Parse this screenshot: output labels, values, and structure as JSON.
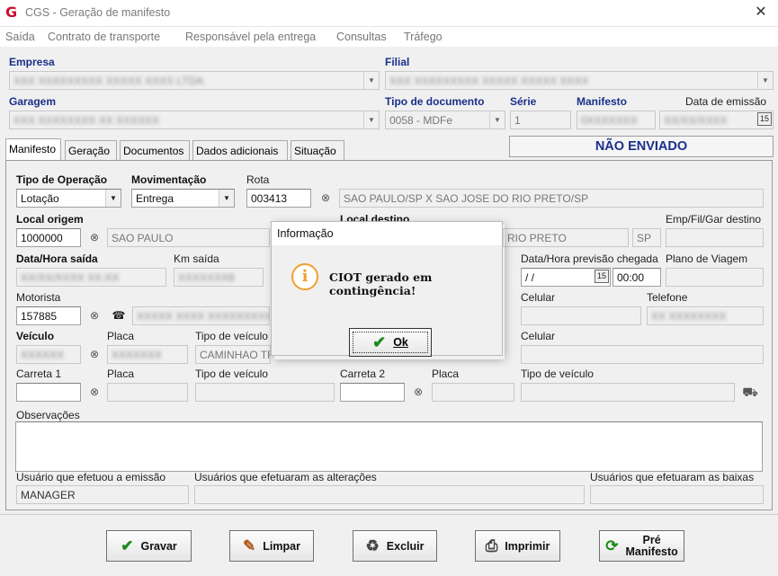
{
  "window": {
    "title": "CGS - Geração de manifesto",
    "close": "✕"
  },
  "menu": [
    "Saída",
    "Contrato de transporte",
    "Responsável pela entrega",
    "Consultas",
    "Tráfego"
  ],
  "header": {
    "empresa_label": "Empresa",
    "empresa_value": "XXX XXXXXXXXX XXXXX XXXX LTDA",
    "filial_label": "Filial",
    "filial_value": "XXX XXXXXXXXX XXXXX XXXXX XXXX",
    "garagem_label": "Garagem",
    "garagem_value": "XXX XXXXXXXX XX XXXXXX",
    "tipo_doc_label": "Tipo de documento",
    "tipo_doc_value": "0058 - MDFe",
    "serie_label": "Série",
    "serie_value": "1",
    "manifesto_label": "Manifesto",
    "manifesto_value": "0XXXXXXX",
    "data_emissao_label": "Data de emissão",
    "data_emissao_value": "XX/XX/XXXX",
    "calendar_glyph": "15"
  },
  "tabs": [
    "Manifesto",
    "Geração",
    "Documentos",
    "Dados adicionais",
    "Situação"
  ],
  "status": "NÃO ENVIADO",
  "form": {
    "tipo_operacao_label": "Tipo de Operação",
    "tipo_operacao_value": "Lotação",
    "movimentacao_label": "Movimentação",
    "movimentacao_value": "Entrega",
    "rota_label": "Rota",
    "rota_value": "003413",
    "rota_desc": "SAO PAULO/SP X SAO JOSE DO RIO PRETO/SP",
    "local_origem_label": "Local origem",
    "local_origem_value": "1000000",
    "local_origem_desc": "SAO PAULO",
    "local_destino_label": "Local destino",
    "local_destino_desc": "RIO PRETO",
    "local_destino_uf": "SP",
    "emp_fil_gar_destino_label": "Emp/Fil/Gar destino",
    "data_hora_saida_label": "Data/Hora saída",
    "data_hora_saida_value": "XX/XX/XXXX XX:XX",
    "km_saida_label": "Km saída",
    "km_saida_value": "XXXXXXX8",
    "data_hora_prev_label": "Data/Hora previsão chegada",
    "data_prev_value": " / /",
    "hora_prev_value": "00:00",
    "plano_viagem_label": "Plano de Viagem",
    "motorista_label": "Motorista",
    "motorista_value": "157885",
    "motorista_desc": "XXXXX XXXX XXXXXXXXX XX",
    "celular_label": "Celular",
    "telefone_label": "Telefone",
    "telefone_value": "XX XXXXXXXX",
    "veiculo_label": "Veículo",
    "veiculo_value": "XXXXXX",
    "placa_label": "Placa",
    "placa_value": "XXXXXXX",
    "tipo_veiculo_label": "Tipo de veículo",
    "tipo_veiculo_value": "CAMINHAO TRUCADO C/ 3 E",
    "celular2_label": "Celular",
    "carreta1_label": "Carreta 1",
    "placa2_label": "Placa",
    "tipo_veiculo2_label": "Tipo de veículo",
    "carreta2_label": "Carreta 2",
    "placa3_label": "Placa",
    "tipo_veiculo3_label": "Tipo de veículo",
    "observacoes_label": "Observações",
    "usuario_emissao_label": "Usuário que efetuou a emissão",
    "usuario_emissao_value": "MANAGER",
    "usuarios_alteracoes_label": "Usuários que efetuaram as alterações",
    "usuarios_baixas_label": "Usuários que efetuaram as baixas"
  },
  "buttons": {
    "gravar": "Gravar",
    "limpar": "Limpar",
    "excluir": "Excluir",
    "imprimir": "Imprimir",
    "pre_manifesto_1": "Pré",
    "pre_manifesto_2": "Manifesto"
  },
  "dialog": {
    "title": "Informação",
    "message": "CIOT gerado em contingência!",
    "ok": "Ok"
  },
  "icons": {
    "search": "binoculars-icon",
    "dropdown": "chevron-down-icon",
    "info": "info-icon",
    "check": "check-icon"
  }
}
